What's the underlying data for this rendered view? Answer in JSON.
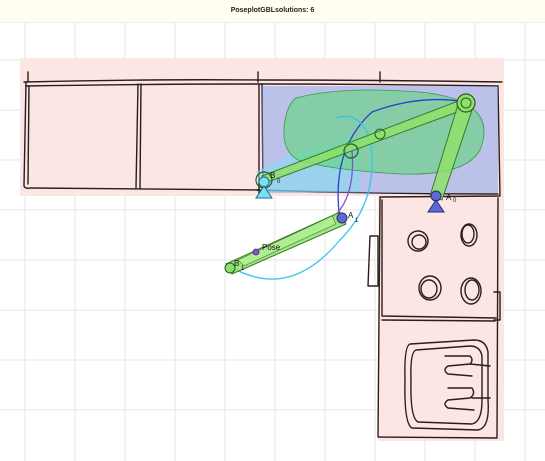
{
  "header": {
    "title": "PoseplotGBLsolutions: 6"
  },
  "labels": {
    "pose": "Pose",
    "a0": "A",
    "a0_sub": "0",
    "b0": "B",
    "b0_sub": "0",
    "a1": "A",
    "a1_sub": "1",
    "b1": "B",
    "b1_sub": "1"
  },
  "colors": {
    "grid": "#e6e6e6",
    "kitchen_fill": "#fbe6e4",
    "sketch": "#2b1d1d",
    "workspace_blue": "#6f94f0",
    "workspace_cyan": "#7de0f0",
    "workspace_green": "#5fd67a",
    "link_green": "#8ee06a",
    "ground_pivot": "#5a6bd6",
    "path_blue": "#2e3fd6",
    "path_cyan": "#37c8e8",
    "path_purple": "#8a4fd0"
  }
}
